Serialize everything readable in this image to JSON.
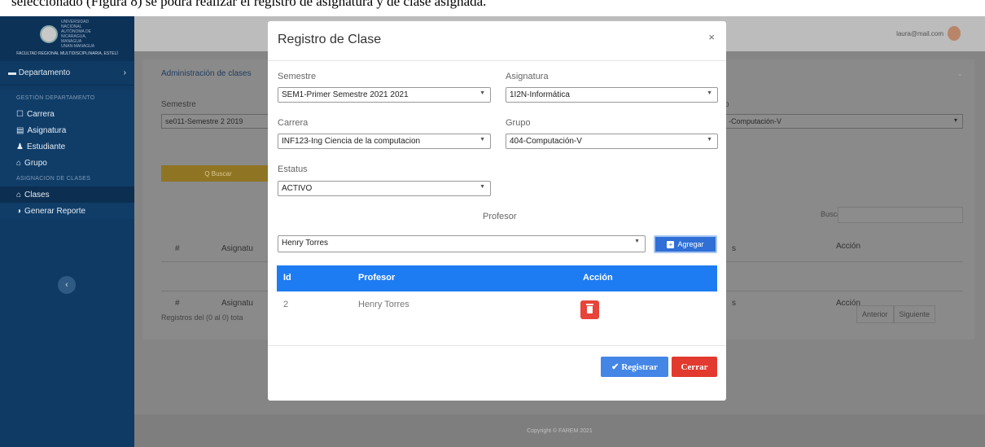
{
  "doc_text": "seleccionado (Figura 8) se podrá realizar el registro de asignatura y de clase asignada.",
  "sidebar": {
    "university_lines": [
      "UNIVERSIDAD",
      "NACIONAL",
      "AUTÓNOMA DE",
      "NICARAGUA,",
      "MANAGUA",
      "UNAN-MANAGUA"
    ],
    "faculty": "FACULTAD REGIONAL MULTIDISCIPLINARIA, ESTELÍ",
    "department": "Departamento",
    "header_gestion": "GESTIÓN DEPARTAMENTO",
    "header_asignacion": "ASIGNACION DE CLASES",
    "items": [
      {
        "icon": "☐",
        "label": "Carrera"
      },
      {
        "icon": "▤",
        "label": "Asignatura"
      },
      {
        "icon": "♟",
        "label": "Estudiante"
      },
      {
        "icon": "⌂",
        "label": "Grupo"
      },
      {
        "icon": "⌂",
        "label": "Clases"
      },
      {
        "icon": "◑",
        "label": "Generar Reporte"
      }
    ]
  },
  "topbar": {
    "user_email": "laura@mail.com"
  },
  "panel": {
    "title": "Administración de clases",
    "semestre_label": "Semestre",
    "semestre_value": "se011-Semestre 2 2019",
    "grupo_label_fragment": "o",
    "grupo_value": "-Computación-V",
    "buscar_button": "Q Buscar",
    "search_label": "Buscar:",
    "col_num": "#",
    "col_asignatura": "Asignatu",
    "col_accion": "Acción",
    "col_fragment": "s",
    "registros": "Registros del (0 al 0) tota",
    "pager_prev": "Anterior",
    "pager_next": "Siguiente"
  },
  "footer": "Copyright © FAREM 2021",
  "modal": {
    "title": "Registro de Clase",
    "close": "×",
    "semestre_label": "Semestre",
    "semestre_value": "SEM1-Primer Semestre 2021 2021",
    "asignatura_label": "Asignatura",
    "asignatura_value": "1I2N-Informática",
    "carrera_label": "Carrera",
    "carrera_value": "INF123-Ing Ciencia de la computacion",
    "grupo_label": "Grupo",
    "grupo_value": "404-Computación-V",
    "estatus_label": "Estatus",
    "estatus_value": "ACTIVO",
    "profesor_label": "Profesor",
    "profesor_value": "Henry Torres",
    "agregar_button": "Agregar",
    "table_headers": {
      "id": "Id",
      "profesor": "Profesor",
      "accion": "Acción"
    },
    "rows": [
      {
        "id": "2",
        "profesor": "Henry Torres"
      }
    ],
    "registrar_button": "Registrar",
    "cerrar_button": "Cerrar"
  },
  "colors": {
    "primary_blue": "#1e7cf2",
    "danger_red": "#e23a2e",
    "sidebar_navy": "#0f3a63"
  }
}
